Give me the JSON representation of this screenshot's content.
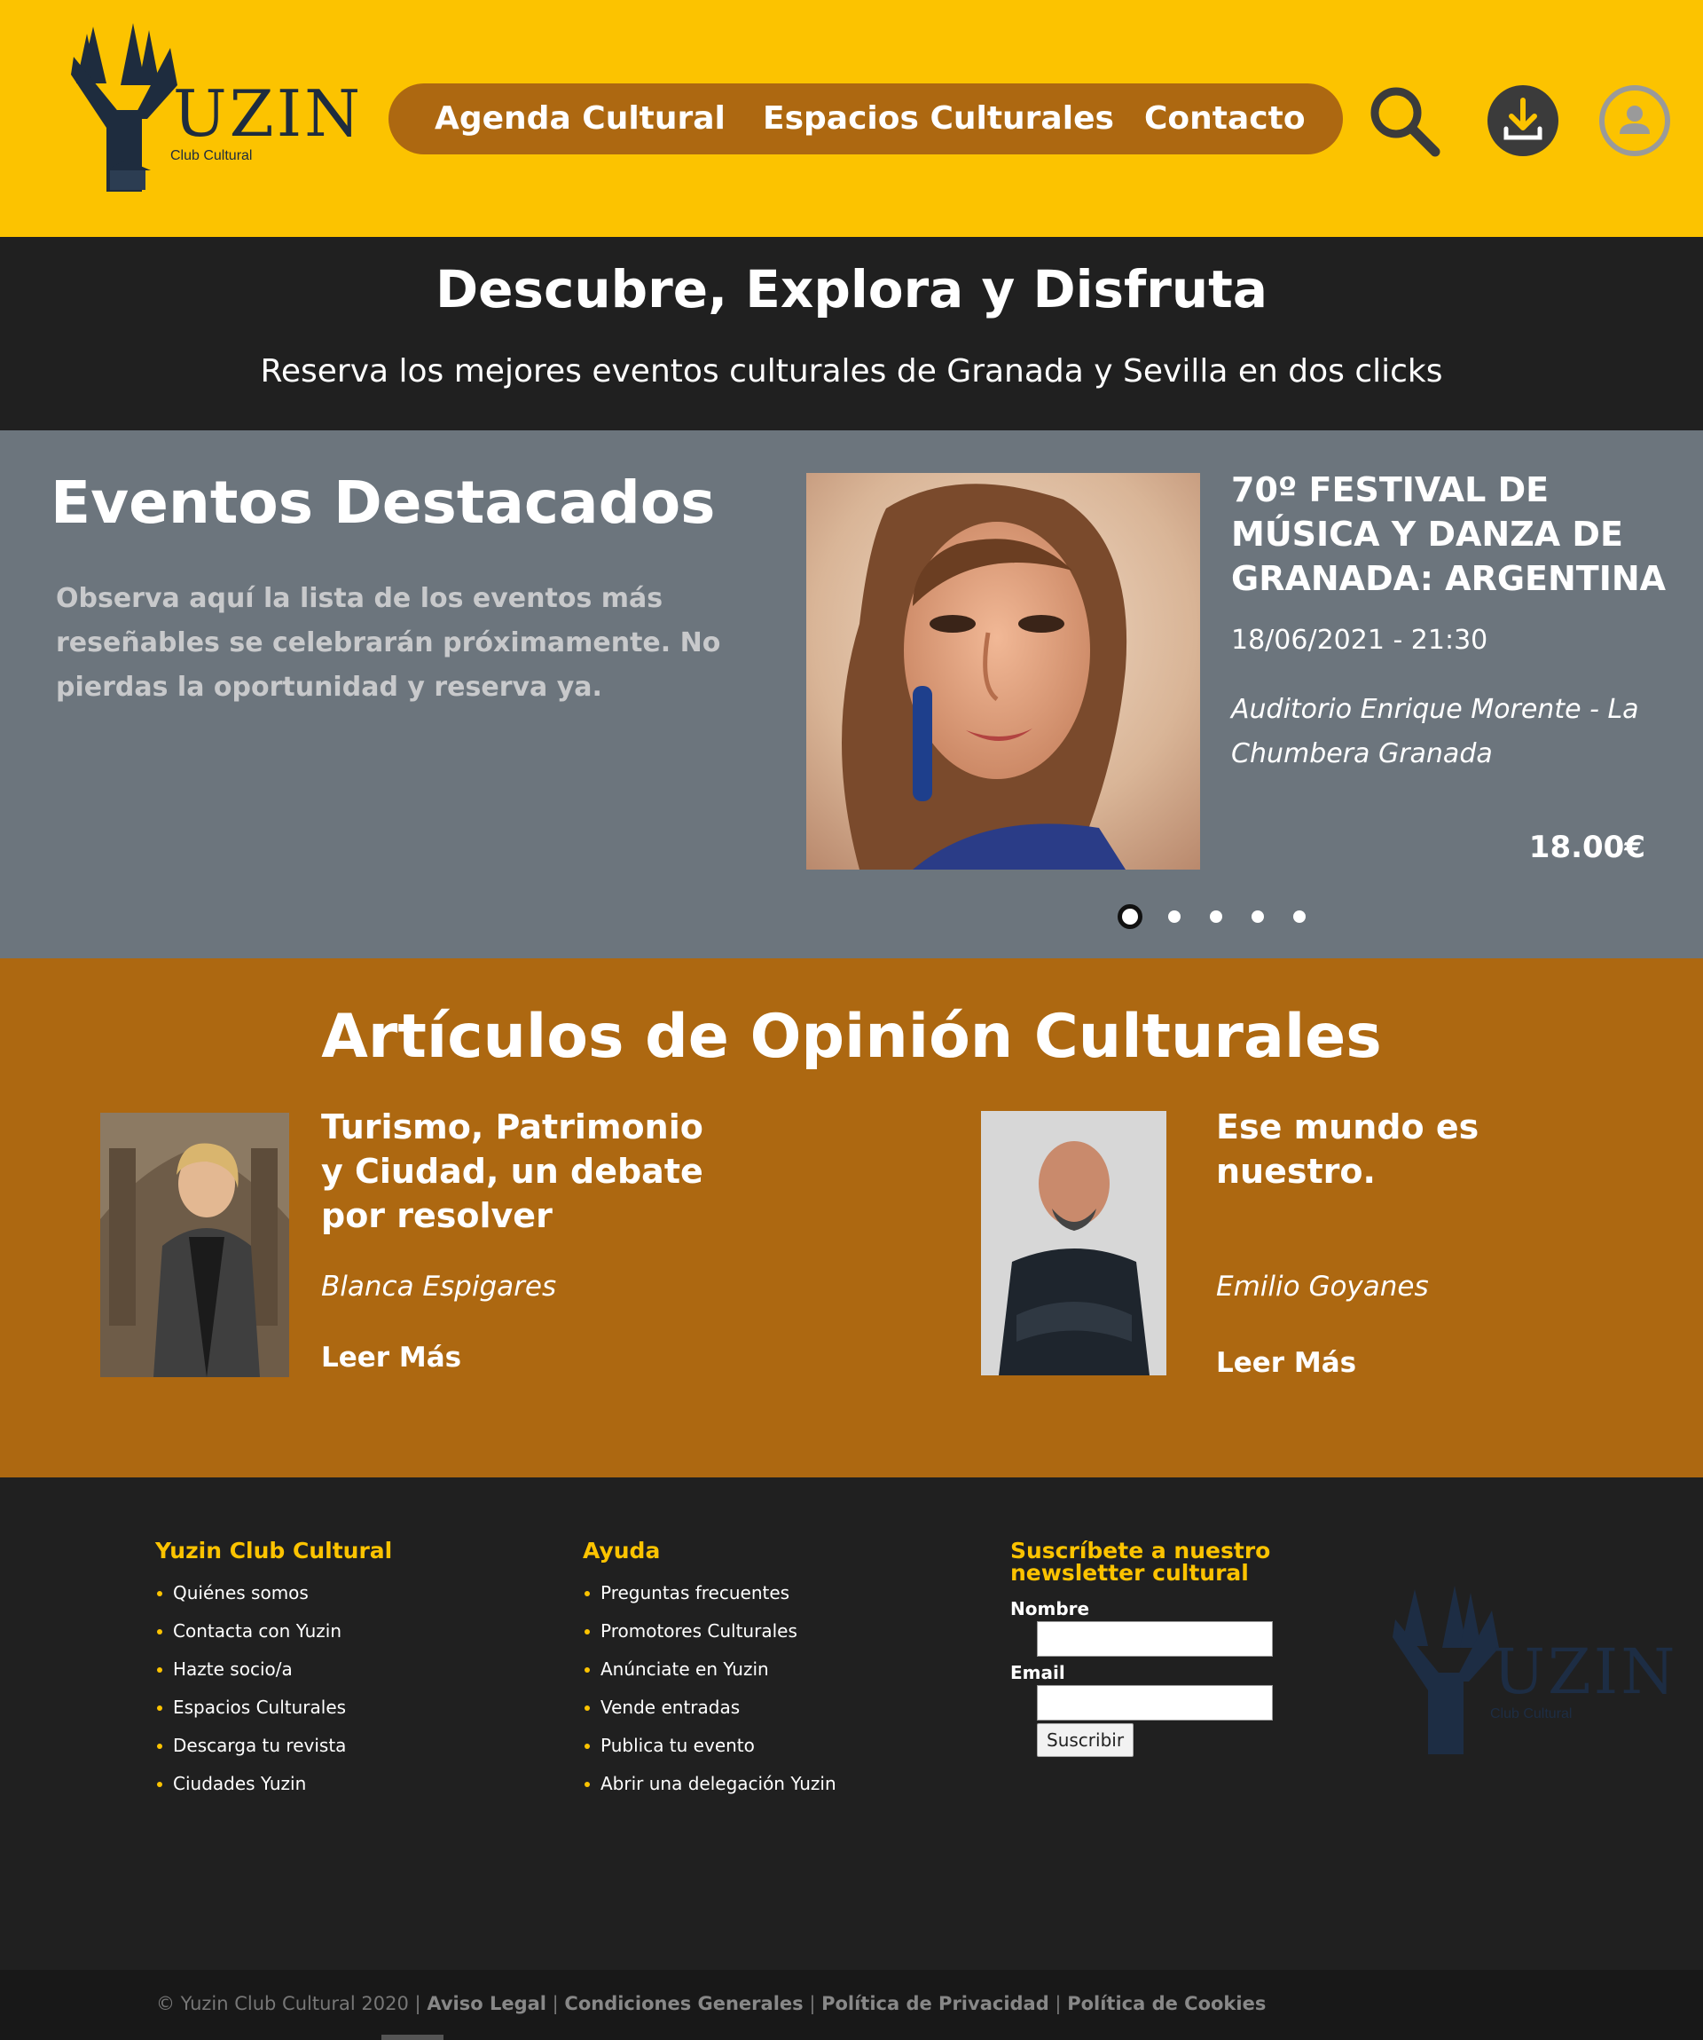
{
  "header": {
    "logo": {
      "wordmark": "UZIN",
      "tagline": "Club Cultural"
    },
    "nav": [
      "Agenda Cultural",
      "Espacios Culturales",
      "Contacto"
    ],
    "icons": [
      "search-icon",
      "download-icon",
      "user-account-icon"
    ],
    "colors": {
      "bar": "#fcc300",
      "nav_pill": "#ad6811"
    }
  },
  "hero": {
    "title": "Descubre, Explora y Disfruta",
    "subtitle": "Reserva los mejores eventos culturales de Granada y Sevilla en dos clicks"
  },
  "featured": {
    "heading": "Eventos Destacados",
    "intro": "Observa aquí la lista de los eventos más reseñables  se celebrarán próximamente. No pierdas la oportunidad y reserva ya.",
    "event": {
      "title": "70º FESTIVAL DE MÚSICA Y DANZA DE GRANADA: ARGENTINA",
      "datetime": "18/06/2021 - 21:30",
      "venue": "Auditorio Enrique Morente - La Chumbera Granada",
      "price": "18.00€"
    },
    "carousel": {
      "slides": 5,
      "active": 1
    }
  },
  "articles": {
    "heading": "Artículos de Opinión Culturales",
    "items": [
      {
        "title": "Turismo, Patrimonio y Ciudad, un debate por resolver",
        "author": "Blanca Espigares",
        "more": "Leer Más"
      },
      {
        "title": "Ese mundo es nuestro.",
        "author": "Emilio Goyanes",
        "more": "Leer Más"
      }
    ]
  },
  "footer": {
    "col1": {
      "title": "Yuzin Club Cultural",
      "links": [
        "Quiénes somos",
        "Contacta con Yuzin",
        "Hazte socio/a",
        "Espacios Culturales",
        "Descarga tu revista",
        "Ciudades Yuzin"
      ]
    },
    "col2": {
      "title": "Ayuda",
      "links": [
        "Preguntas frecuentes",
        "Promotores Culturales",
        "Anúnciate en Yuzin",
        "Vende entradas",
        "Publica tu evento",
        "Abrir una delegación Yuzin"
      ]
    },
    "newsletter": {
      "title": "Suscríbete a nuestro newsletter cultural",
      "name_label": "Nombre",
      "email_label": "Email",
      "submit": "Suscribir"
    },
    "logo": {
      "wordmark": "UZIN",
      "tagline": "Club Cultural"
    }
  },
  "bottom": {
    "copyright": "© Yuzin Club Cultural 2020",
    "sep": " | ",
    "links": [
      "Aviso Legal",
      "Condiciones Generales",
      "Política de Privacidad",
      "Política de Cookies"
    ]
  }
}
